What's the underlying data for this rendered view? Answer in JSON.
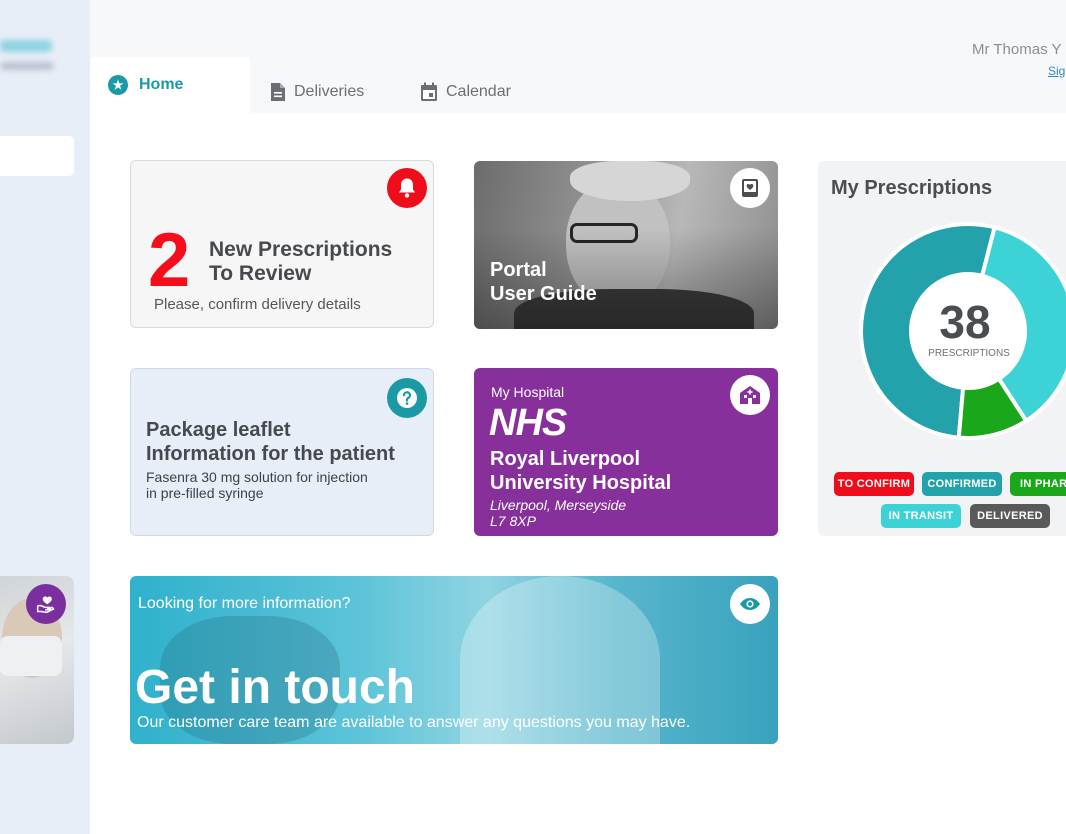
{
  "user": {
    "name": "Mr Thomas Y",
    "sign_out": "Sig"
  },
  "tabs": [
    {
      "label": "Home",
      "icon": "star-icon",
      "active": true
    },
    {
      "label": "Deliveries",
      "icon": "document-icon",
      "active": false
    },
    {
      "label": "Calendar",
      "icon": "calendar-icon",
      "active": false
    }
  ],
  "review_card": {
    "count": "2",
    "title_line1": "New Prescriptions",
    "title_line2": "To Review",
    "subtitle": "Please, confirm delivery details",
    "icon": "bell-icon",
    "color": "#f40e1c"
  },
  "guide_card": {
    "line1": "Portal",
    "line2": "User Guide",
    "icon": "book-icon"
  },
  "leaflet_card": {
    "title_line1": "Package leaflet",
    "title_line2": "Information for the patient",
    "desc_line1": "Fasenra 30 mg solution for injection",
    "desc_line2": "in pre-filled syringe",
    "icon": "question-icon"
  },
  "hospital_card": {
    "label": "My Hospital",
    "logo_text": "NHS",
    "name_line1": "Royal Liverpool",
    "name_line2": "University Hospital",
    "addr_line1": "Liverpool, Merseyside",
    "addr_line2": "L7 8XP",
    "icon": "hospital-icon",
    "color": "#87309b"
  },
  "touch_card": {
    "pre": "Looking for more information?",
    "title": "Get in touch",
    "subtitle": "Our customer care team are available to answer any questions you may have.",
    "icon": "eye-icon"
  },
  "prescriptions": {
    "title": "My Prescriptions",
    "total": "38",
    "total_label": "PRESCRIPTIONS",
    "statuses": [
      {
        "label": "TO CONFIRM",
        "color": "#f00d1b"
      },
      {
        "label": "CONFIRMED",
        "color": "#24a2ac"
      },
      {
        "label": "IN PHAR",
        "color": "#1aa81a"
      },
      {
        "label": "IN TRANSIT",
        "color": "#3dd3d6"
      },
      {
        "label": "DELIVERED",
        "color": "#595959"
      }
    ]
  },
  "chart_data": {
    "type": "pie",
    "style": "donut",
    "series": [
      {
        "name": "CONFIRMED",
        "value": 20,
        "color": "#24a2ac"
      },
      {
        "name": "IN PHAR",
        "value": 4,
        "color": "#1aa81a"
      },
      {
        "name": "IN TRANSIT",
        "value": 14,
        "color": "#3dd3d6"
      }
    ]
  },
  "sidebar": {
    "card_icon": "heart-hand-icon"
  }
}
